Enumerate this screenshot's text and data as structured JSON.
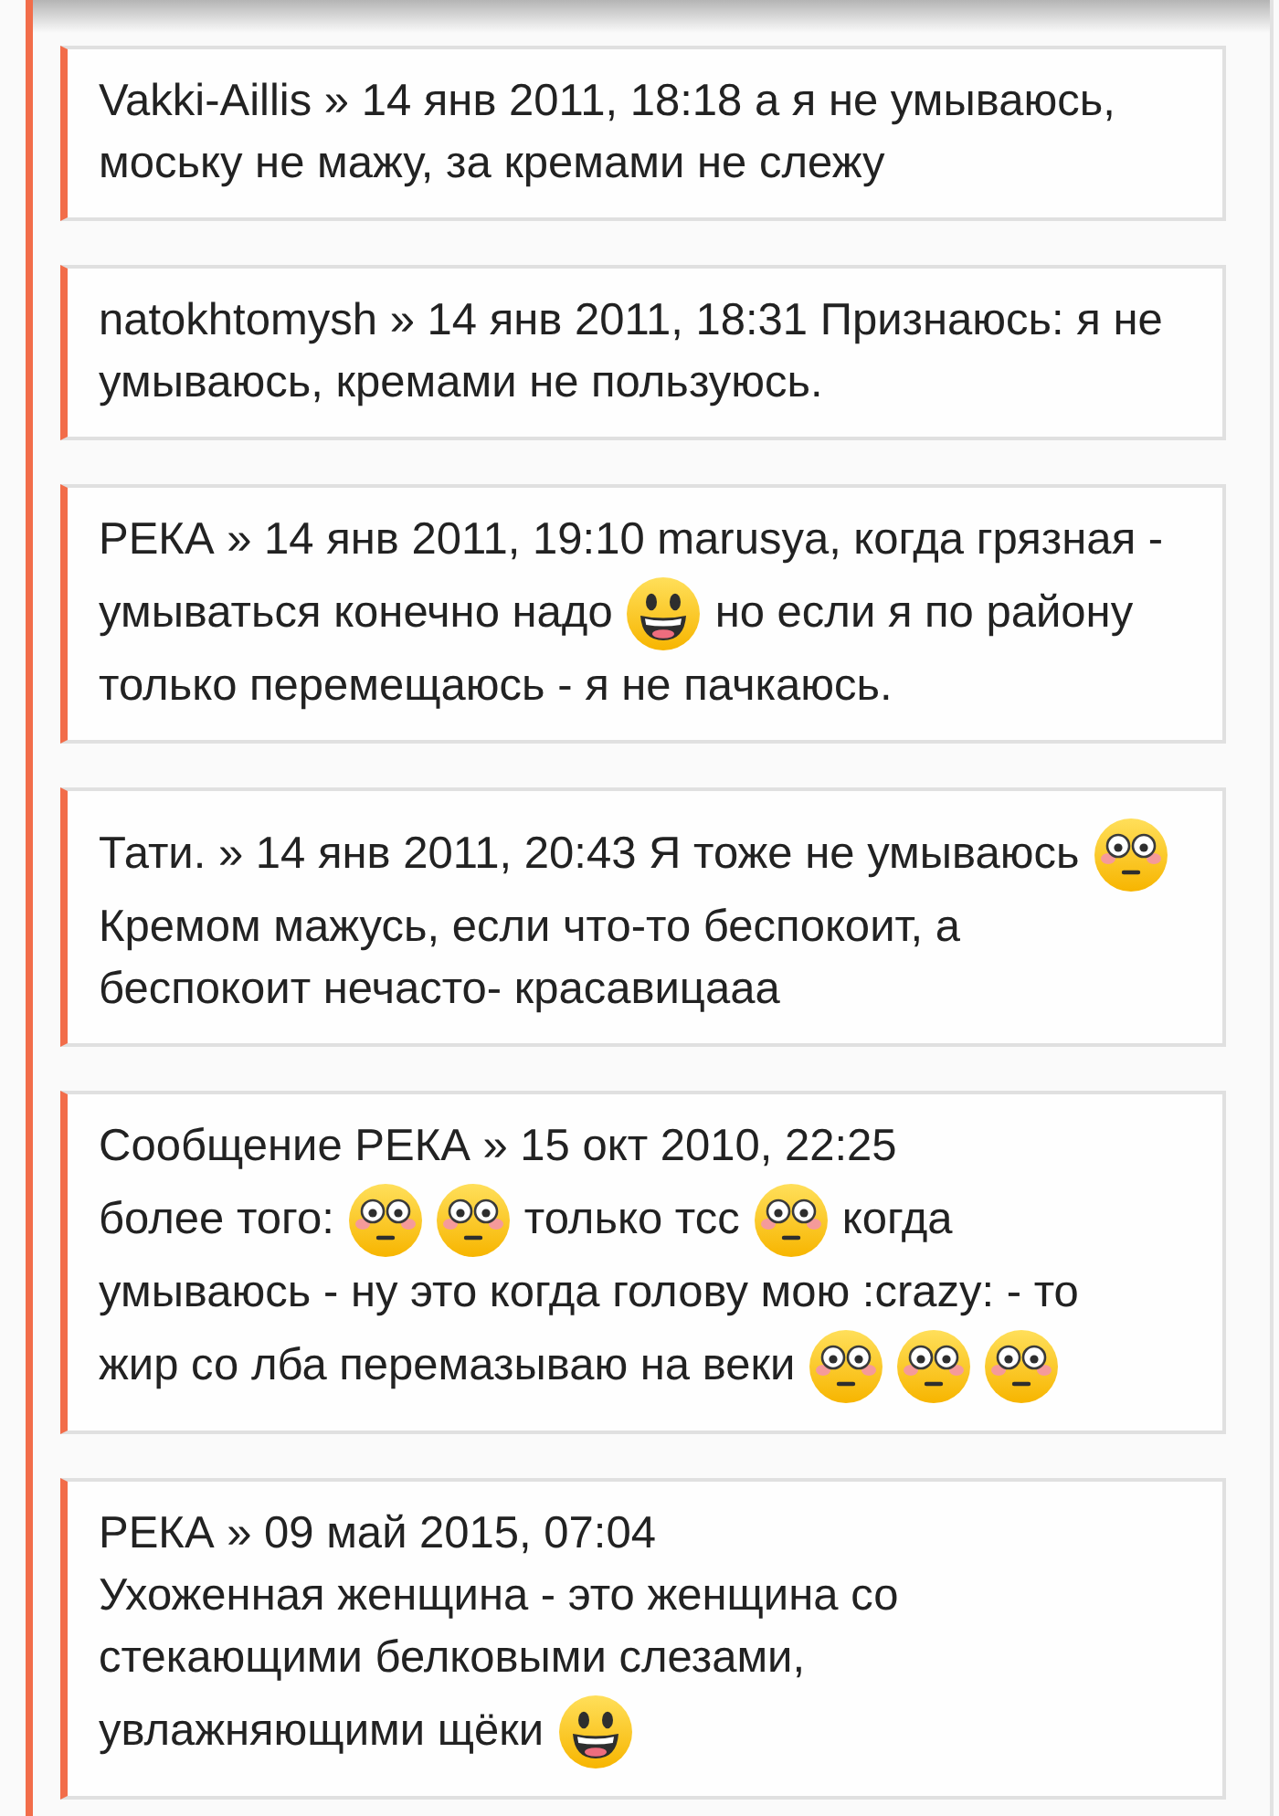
{
  "posts": [
    {
      "lines": [
        [
          {
            "kind": "text",
            "text": "Vakki-Aillis » 14 янв 2011, 18:18 а я не умываюсь,"
          }
        ],
        [
          {
            "kind": "text",
            "text": "моську не мажу, за кремами не слежу"
          }
        ]
      ]
    },
    {
      "lines": [
        [
          {
            "kind": "text",
            "text": "natokhtomysh » 14 янв 2011, 18:31 Признаюсь: я не"
          }
        ],
        [
          {
            "kind": "text",
            "text": "умываюсь, кремами не пользуюсь."
          }
        ]
      ]
    },
    {
      "lines": [
        [
          {
            "kind": "text",
            "text": "РЕКА » 14 янв 2011, 19:10 marusya, когда грязная -"
          }
        ],
        [
          {
            "kind": "text",
            "text": "умываться конечно надо"
          },
          {
            "kind": "grinning"
          },
          {
            "kind": "text",
            "text": "но если я по району"
          }
        ],
        [
          {
            "kind": "text",
            "text": "только перемещаюсь - я не пачкаюсь."
          }
        ]
      ]
    },
    {
      "lines": [
        [
          {
            "kind": "text",
            "text": "Тати. » 14 янв 2011, 20:43 Я тоже не умываюсь"
          },
          {
            "kind": "flushed"
          }
        ],
        [
          {
            "kind": "text",
            "text": "Кремом мажусь, если что-то беспокоит, а"
          }
        ],
        [
          {
            "kind": "text",
            "text": "беспокоит нечасто- красавицааа"
          }
        ]
      ]
    },
    {
      "lines": [
        [
          {
            "kind": "text",
            "text": "Сообщение РЕКА » 15 окт 2010, 22:25"
          }
        ],
        [
          {
            "kind": "text",
            "text": "более того:"
          },
          {
            "kind": "flushed"
          },
          {
            "kind": "flushed"
          },
          {
            "kind": "text",
            "text": "только тсс"
          },
          {
            "kind": "flushed"
          },
          {
            "kind": "text",
            "text": "когда"
          }
        ],
        [
          {
            "kind": "text",
            "text": "умываюсь - ну это когда голову мою :crazy: - то"
          }
        ],
        [
          {
            "kind": "text",
            "text": "жир со лба перемазываю на веки"
          },
          {
            "kind": "flushed"
          },
          {
            "kind": "flushed"
          },
          {
            "kind": "flushed"
          }
        ]
      ]
    },
    {
      "lines": [
        [
          {
            "kind": "text",
            "text": "РЕКА » 09 май 2015, 07:04"
          }
        ],
        [
          {
            "kind": "text",
            "text": "Ухоженная женщина - это женщина со"
          }
        ],
        [
          {
            "kind": "text",
            "text": "стекающими белковыми слезами,"
          }
        ],
        [
          {
            "kind": "text",
            "text": "увлажняющими щёки"
          },
          {
            "kind": "grinning"
          }
        ]
      ]
    }
  ]
}
